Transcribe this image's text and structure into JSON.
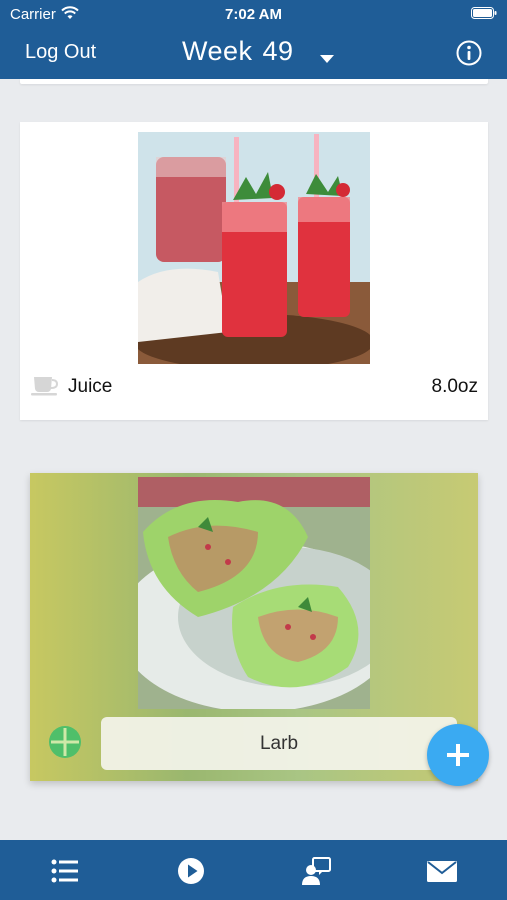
{
  "status_bar": {
    "carrier": "Carrier",
    "time": "7:02 AM"
  },
  "nav": {
    "logout_label": "Log Out",
    "week_label": "Week",
    "week_number": "49"
  },
  "cards": [
    {
      "name": "Juice",
      "amount": "8.0oz"
    },
    {
      "name": "Larb"
    }
  ],
  "colors": {
    "nav_bg": "#1f5d97",
    "fab": "#3aaaf2",
    "page_bg": "#e9ebee"
  },
  "icons": {
    "info": "info-icon",
    "dropdown": "caret-down-icon",
    "cup": "coffee-cup-icon",
    "leaf": "leaf-icon",
    "add": "plus-icon",
    "tabs": [
      "list-icon",
      "play-icon",
      "contact-icon",
      "mail-icon"
    ]
  }
}
